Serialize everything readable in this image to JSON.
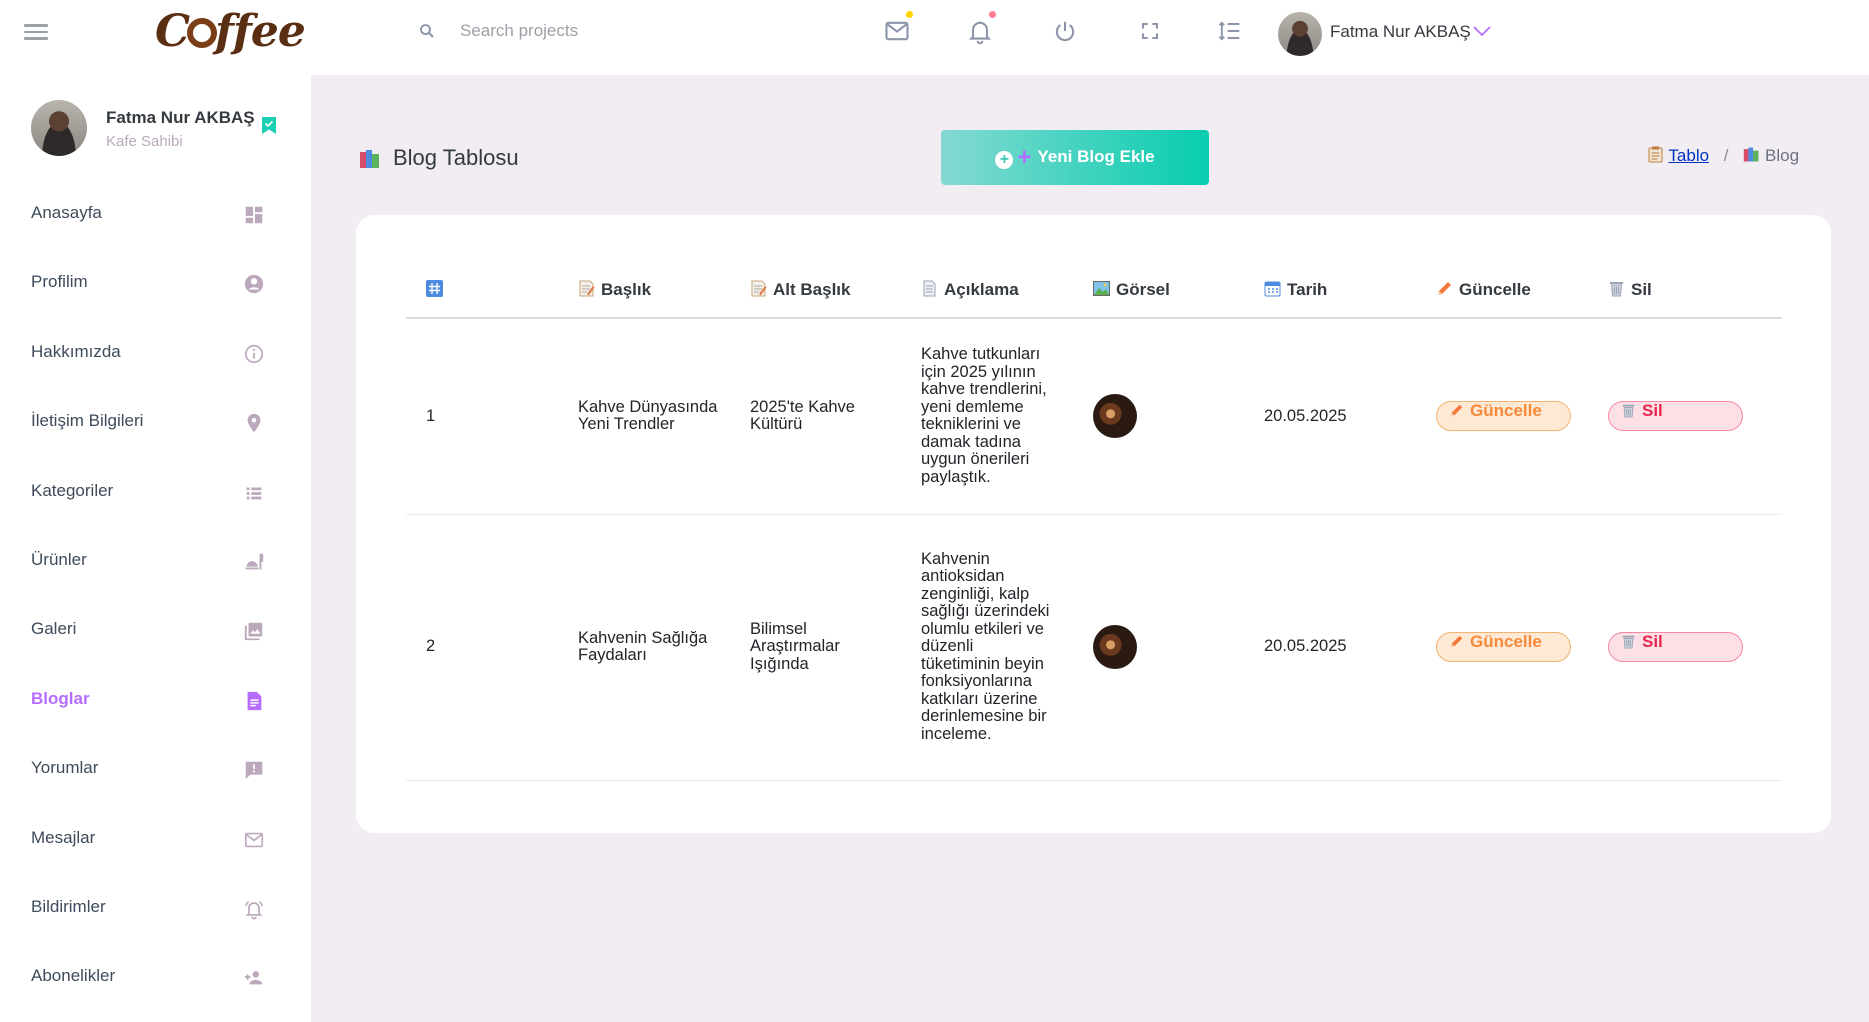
{
  "navbar": {
    "brand": "Coffee",
    "search_placeholder": "Search projects",
    "user_name": "Fatma Nur AKBAŞ",
    "icons": [
      "menu-icon",
      "search-icon",
      "mail-icon",
      "bell-icon",
      "power-icon",
      "fullscreen-icon",
      "list-icon",
      "chevron-down-icon"
    ],
    "mail_dot_color": "#ffd500",
    "bell_dot_color": "#fe7c96"
  },
  "sidebar": {
    "profile_name": "Fatma Nur AKBAŞ",
    "profile_role": "Kafe Sahibi",
    "items": [
      {
        "label": "Anasayfa",
        "icon": "dashboard-icon"
      },
      {
        "label": "Profilim",
        "icon": "account-circle-icon"
      },
      {
        "label": "Hakkımızda",
        "icon": "info-icon"
      },
      {
        "label": "İletişim Bilgileri",
        "icon": "location-pin-icon"
      },
      {
        "label": "Kategoriler",
        "icon": "list-view-icon"
      },
      {
        "label": "Ürünler",
        "icon": "food-icon"
      },
      {
        "label": "Galeri",
        "icon": "gallery-icon"
      },
      {
        "label": "Bloglar",
        "icon": "blog-icon"
      },
      {
        "label": "Yorumlar",
        "icon": "comment-icon"
      },
      {
        "label": "Mesajlar",
        "icon": "mail-icon"
      },
      {
        "label": "Bildirimler",
        "icon": "bell-ring-icon"
      },
      {
        "label": "Abonelikler",
        "icon": "user-add-icon"
      }
    ],
    "active_item": "Bloglar"
  },
  "page": {
    "title": "Blog Tablosu",
    "add_button": "Yeni Blog Ekle",
    "breadcrumb": {
      "parent": "Tablo",
      "current": "Blog"
    }
  },
  "table": {
    "headers": [
      "#",
      "Başlık",
      "Alt Başlık",
      "Açıklama",
      "Görsel",
      "Tarih",
      "Güncelle",
      "Sil"
    ],
    "rows": [
      {
        "no": "1",
        "title": "Kahve Dünyasında Yeni Trendler",
        "subtitle": "2025'te Kahve Kültürü",
        "description": "Kahve tutkunları için 2025 yılının kahve trendlerini, yeni demleme tekniklerini ve damak tadına uygun önerileri paylaştık.",
        "date": "20.05.2025",
        "update_label": "Güncelle",
        "delete_label": "Sil"
      },
      {
        "no": "2",
        "title": "Kahvenin Sağlığa Faydaları",
        "subtitle": "Bilimsel Araştırmalar Işığında",
        "description": "Kahvenin antioksidan zenginliği, kalp sağlığı üzerindeki olumlu etkileri ve düzenli tüketiminin beyin fonksiyonlarına katkıları üzerine derinlemesine bir inceleme.",
        "date": "20.05.2025",
        "update_label": "Güncelle",
        "delete_label": "Sil"
      }
    ]
  },
  "colors": {
    "accent": "#b66dff",
    "add_button_gradient": [
      "#84d9d2",
      "#07cdae"
    ],
    "update_button": "#f7893a",
    "delete_button": "#e8274d"
  }
}
